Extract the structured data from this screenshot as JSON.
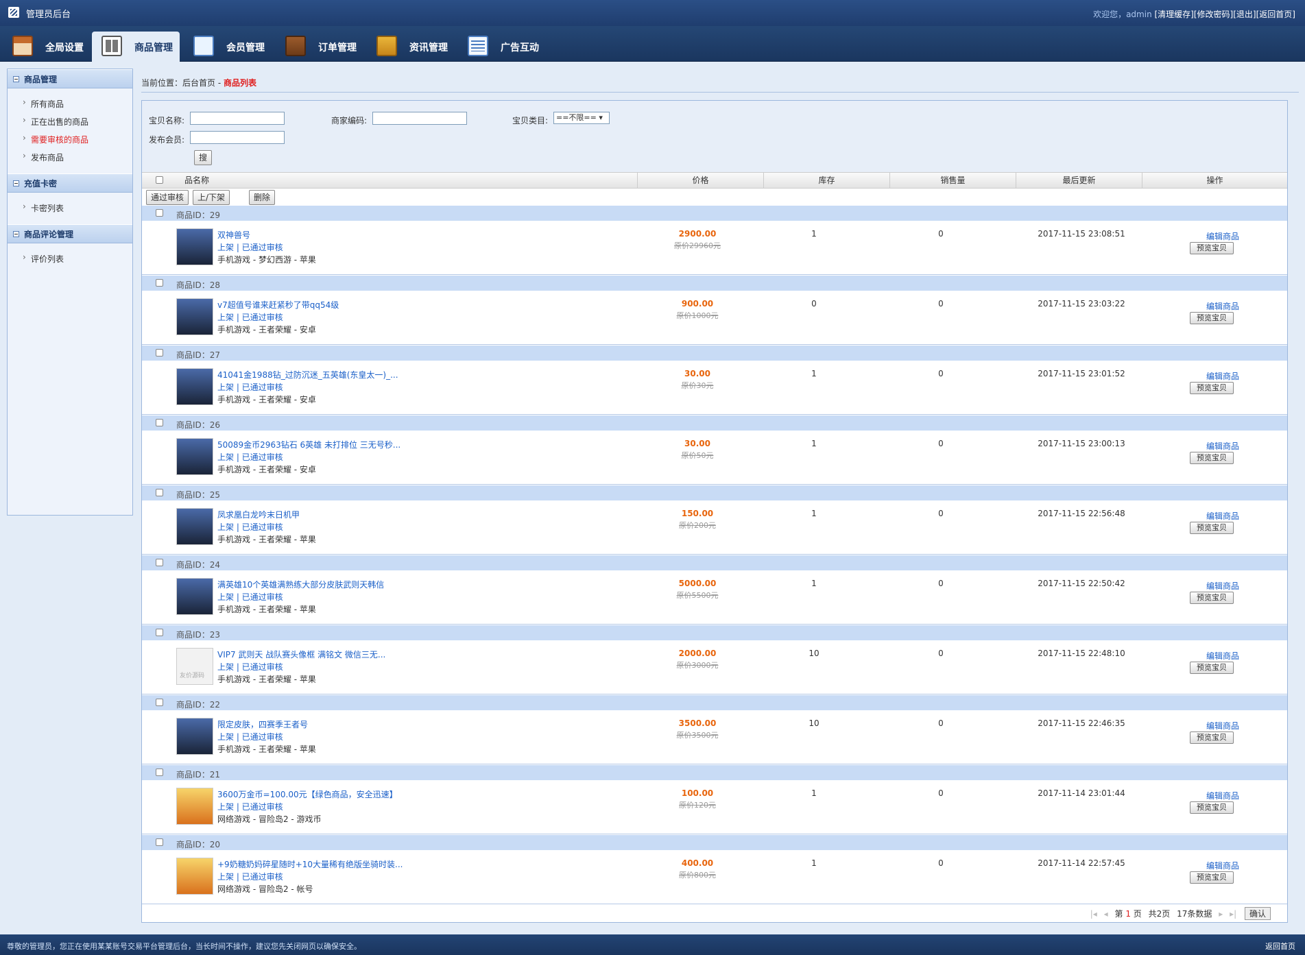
{
  "topbar": {
    "title": "管理员后台",
    "welcome": "欢迎您，admin ",
    "links": [
      "[清理缓存]",
      "[修改密码]",
      "[退出]",
      "[返回首页]"
    ]
  },
  "nav": [
    {
      "label": "全局设置",
      "icon": "home-icon"
    },
    {
      "label": "商品管理",
      "icon": "goods-icon"
    },
    {
      "label": "会员管理",
      "icon": "member-icon"
    },
    {
      "label": "订单管理",
      "icon": "order-icon"
    },
    {
      "label": "资讯管理",
      "icon": "news-icon"
    },
    {
      "label": "广告互动",
      "icon": "ad-icon"
    }
  ],
  "sidebar": {
    "sections": [
      {
        "title": "商品管理",
        "items": [
          "所有商品",
          "正在出售的商品",
          "需要审核的商品",
          "发布商品"
        ]
      },
      {
        "title": "充值卡密",
        "items": [
          "卡密列表"
        ]
      },
      {
        "title": "商品评论管理",
        "items": [
          "评价列表"
        ]
      }
    ]
  },
  "breadcrumb": {
    "prefix": "当前位置：后台首页 - ",
    "current": "商品列表"
  },
  "search": {
    "name_label": "宝贝名称:",
    "code_label": "商家编码:",
    "category_label": "宝贝类目:",
    "category_value": "==不限== ▾",
    "member_label": "发布会员:",
    "search_button": "搜"
  },
  "table": {
    "headers": [
      "品名称",
      "价格",
      "库存",
      "销售量",
      "最后更新",
      "操作"
    ],
    "bulk_buttons": [
      "通过审核",
      "上/下架",
      "删除"
    ]
  },
  "rows": [
    {
      "id_label": "商品ID：29",
      "title": "双神兽号",
      "status": "上架 | 已通过审核",
      "category": "手机游戏 - 梦幻西游 - 苹果",
      "price": "2900.00",
      "orig": "原价29960元",
      "stock": "1",
      "sales": "0",
      "time": "2017-11-15 23:08:51",
      "edit": "编辑商品",
      "preview": "预览宝贝"
    },
    {
      "id_label": "商品ID：28",
      "title": "v7超值号谁来赶紧秒了带qq54级",
      "status": "上架 | 已通过审核",
      "category": "手机游戏 - 王者荣耀 - 安卓",
      "price": "900.00",
      "orig": "原价1000元",
      "stock": "0",
      "sales": "0",
      "time": "2017-11-15 23:03:22",
      "edit": "编辑商品",
      "preview": "预览宝贝"
    },
    {
      "id_label": "商品ID：27",
      "title": "41041金1988钻_过防沉迷_五英雄(东皇太一)_...",
      "status": "上架 | 已通过审核",
      "category": "手机游戏 - 王者荣耀 - 安卓",
      "price": "30.00",
      "orig": "原价30元",
      "stock": "1",
      "sales": "0",
      "time": "2017-11-15 23:01:52",
      "edit": "编辑商品",
      "preview": "预览宝贝"
    },
    {
      "id_label": "商品ID：26",
      "title": "50089金币2963钻石 6英雄 未打排位 三无号秒...",
      "status": "上架 | 已通过审核",
      "category": "手机游戏 - 王者荣耀 - 安卓",
      "price": "30.00",
      "orig": "原价50元",
      "stock": "1",
      "sales": "0",
      "time": "2017-11-15 23:00:13",
      "edit": "编辑商品",
      "preview": "预览宝贝"
    },
    {
      "id_label": "商品ID：25",
      "title": "凤求凰白龙吟末日机甲",
      "status": "上架 | 已通过审核",
      "category": "手机游戏 - 王者荣耀 - 苹果",
      "price": "150.00",
      "orig": "原价200元",
      "stock": "1",
      "sales": "0",
      "time": "2017-11-15 22:56:48",
      "edit": "编辑商品",
      "preview": "预览宝贝"
    },
    {
      "id_label": "商品ID：24",
      "title": "满英雄10个英雄满熟练大部分皮肤武则天韩信",
      "status": "上架 | 已通过审核",
      "category": "手机游戏 - 王者荣耀 - 苹果",
      "price": "5000.00",
      "orig": "原价5500元",
      "stock": "1",
      "sales": "0",
      "time": "2017-11-15 22:50:42",
      "edit": "编辑商品",
      "preview": "预览宝贝"
    },
    {
      "id_label": "商品ID：23",
      "title": "VIP7 武则天 战队赛头像框 满铭文 微信三无...",
      "status": "上架 | 已通过审核",
      "category": "手机游戏 - 王者荣耀 - 苹果",
      "price": "2000.00",
      "orig": "原价3000元",
      "stock": "10",
      "sales": "0",
      "time": "2017-11-15 22:48:10",
      "edit": "编辑商品",
      "preview": "预览宝贝"
    },
    {
      "id_label": "商品ID：22",
      "title": "限定皮肤，四赛季王者号",
      "status": "上架 | 已通过审核",
      "category": "手机游戏 - 王者荣耀 - 苹果",
      "price": "3500.00",
      "orig": "原价3500元",
      "stock": "10",
      "sales": "0",
      "time": "2017-11-15 22:46:35",
      "edit": "编辑商品",
      "preview": "预览宝贝"
    },
    {
      "id_label": "商品ID：21",
      "title": "3600万金币=100.00元【绿色商品，安全迅速】",
      "status": "上架 | 已通过审核",
      "category": "网络游戏 - 冒险岛2 - 游戏币",
      "price": "100.00",
      "orig": "原价120元",
      "stock": "1",
      "sales": "0",
      "time": "2017-11-14 23:01:44",
      "edit": "编辑商品",
      "preview": "预览宝贝"
    },
    {
      "id_label": "商品ID：20",
      "title": "+9奶糖奶妈碎星随时+10大量稀有绝版坐骑时装...",
      "status": "上架 | 已通过审核",
      "category": "网络游戏 - 冒险岛2 - 帐号",
      "price": "400.00",
      "orig": "原价800元",
      "stock": "1",
      "sales": "0",
      "time": "2017-11-14 22:57:45",
      "edit": "编辑商品",
      "preview": "预览宝贝"
    }
  ],
  "pager": {
    "page_prefix": "第",
    "current": "1",
    "page_suffix": "页",
    "total": "共2页",
    "count": "17条数据",
    "confirm": "确认"
  },
  "footer": {
    "message": "尊敬的管理员，您正在使用某某账号交易平台管理后台，当长时间不操作，建议您先关闭网页以确保安全。",
    "home": "返回首页"
  }
}
